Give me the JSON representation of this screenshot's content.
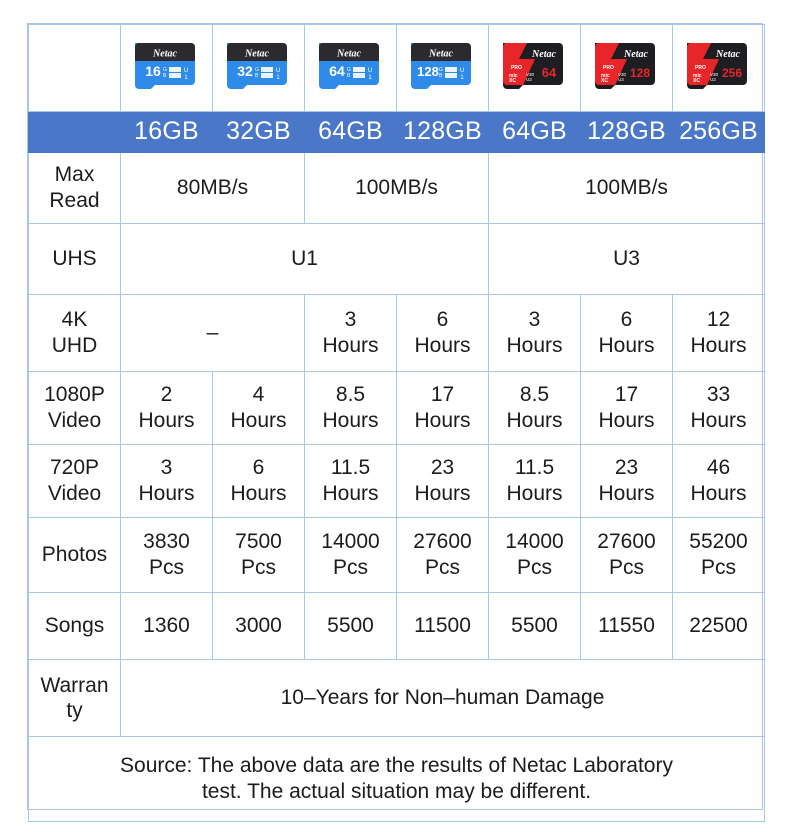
{
  "table": {
    "capacities": [
      "16GB",
      "32GB",
      "64GB",
      "128GB",
      "64GB",
      "128GB",
      "256GB"
    ],
    "cards": [
      {
        "type": "blue",
        "capacity": "16",
        "brand": "Netac"
      },
      {
        "type": "blue",
        "capacity": "32",
        "brand": "Netac"
      },
      {
        "type": "blue",
        "capacity": "64",
        "brand": "Netac"
      },
      {
        "type": "blue",
        "capacity": "128",
        "brand": "Netac"
      },
      {
        "type": "red",
        "capacity": "64",
        "brand": "Netac",
        "badge": "PRO"
      },
      {
        "type": "red",
        "capacity": "128",
        "brand": "Netac",
        "badge": "PRO"
      },
      {
        "type": "red",
        "capacity": "256",
        "brand": "Netac",
        "badge": "PRO"
      }
    ],
    "rows": {
      "max_read": {
        "label_line1": "Max",
        "label_line2": "Read",
        "values": [
          "80MB/s",
          "100MB/s",
          "100MB/s"
        ]
      },
      "uhs": {
        "label": "UHS",
        "values": [
          "U1",
          "U3"
        ]
      },
      "uhd_4k": {
        "label_line1": "4K",
        "label_line2": "UHD",
        "merged_value": "–",
        "values": [
          {
            "num": "3",
            "unit": "Hours"
          },
          {
            "num": "6",
            "unit": "Hours"
          },
          {
            "num": "3",
            "unit": "Hours"
          },
          {
            "num": "6",
            "unit": "Hours"
          },
          {
            "num": "12",
            "unit": "Hours"
          }
        ]
      },
      "video_1080p": {
        "label_line1": "1080P",
        "label_line2": "Video",
        "values": [
          {
            "num": "2",
            "unit": "Hours"
          },
          {
            "num": "4",
            "unit": "Hours"
          },
          {
            "num": "8.5",
            "unit": "Hours"
          },
          {
            "num": "17",
            "unit": "Hours"
          },
          {
            "num": "8.5",
            "unit": "Hours"
          },
          {
            "num": "17",
            "unit": "Hours"
          },
          {
            "num": "33",
            "unit": "Hours"
          }
        ]
      },
      "video_720p": {
        "label_line1": "720P",
        "label_line2": "Video",
        "values": [
          {
            "num": "3",
            "unit": "Hours"
          },
          {
            "num": "6",
            "unit": "Hours"
          },
          {
            "num": "11.5",
            "unit": "Hours"
          },
          {
            "num": "23",
            "unit": "Hours"
          },
          {
            "num": "11.5",
            "unit": "Hours"
          },
          {
            "num": "23",
            "unit": "Hours"
          },
          {
            "num": "46",
            "unit": "Hours"
          }
        ]
      },
      "photos": {
        "label": "Photos",
        "values": [
          {
            "num": "3830",
            "unit": "Pcs"
          },
          {
            "num": "7500",
            "unit": "Pcs"
          },
          {
            "num": "14000",
            "unit": "Pcs"
          },
          {
            "num": "27600",
            "unit": "Pcs"
          },
          {
            "num": "14000",
            "unit": "Pcs"
          },
          {
            "num": "27600",
            "unit": "Pcs"
          },
          {
            "num": "55200",
            "unit": "Pcs"
          }
        ]
      },
      "songs": {
        "label": "Songs",
        "values": [
          "1360",
          "3000",
          "5500",
          "11500",
          "5500",
          "11550",
          "22500"
        ]
      },
      "warranty": {
        "label_line1": "Warran",
        "label_line2": "ty",
        "value": "10–Years for Non–human Damage"
      },
      "source": {
        "line1": "Source: The above data are the results of Netac Laboratory",
        "line2": "test. The actual situation may be different."
      }
    }
  },
  "colors": {
    "header_blue": "#4a77c8",
    "border_blue": "#a9c6e8",
    "card_blue": "#2f8bea",
    "card_red": "#e8262a",
    "card_black": "#2b2b2f",
    "text": "#1c1c1c"
  }
}
